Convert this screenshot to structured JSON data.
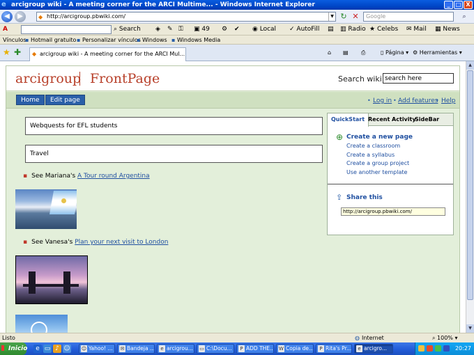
{
  "window": {
    "title": "arcigroup wiki - A meeting corner for the ARCI Multime... - Windows Internet Explorer",
    "min": "_",
    "max": "□",
    "close": "X"
  },
  "address_bar": {
    "url": "http://arcigroup.pbwiki.com/",
    "search_placeholder": "Google"
  },
  "toolbar": {
    "search_label": "Search",
    "count": "49",
    "local": "Local",
    "autofill": "AutoFill",
    "radio": "Radio",
    "celebs": "Celebs",
    "mail": "Mail",
    "news": "News"
  },
  "links_bar": {
    "label": "Vínculos",
    "items": [
      "Hotmail gratuito",
      "Personalizar vínculos",
      "Windows",
      "Windows Media"
    ]
  },
  "tab": {
    "title": "arcigroup wiki - A meeting corner for the ARCI Mul...",
    "pagina": "Página",
    "herramientas": "Herramientas"
  },
  "page": {
    "logo": "arcigroup",
    "title": "FrontPage",
    "search_label": "Search wiki:",
    "search_value": "search here",
    "nav": {
      "home": "Home",
      "edit": "Edit page",
      "login": "Log in",
      "add_features": "Add features",
      "help": "Help"
    },
    "boxes": [
      "Webquests for EFL students",
      "Travel"
    ],
    "bullets": [
      {
        "prefix": "See Mariana's ",
        "link": "A Tour round Argentina"
      },
      {
        "prefix": "See Vanesa's ",
        "link": "Plan your next visit to London"
      }
    ]
  },
  "sidebar": {
    "tabs": [
      "QuickStart",
      "Recent Activity",
      "SideBar"
    ],
    "create_title": "Create a new page",
    "create_links": [
      "Create a classroom",
      "Create a syllabus",
      "Create a group project",
      "Use another template"
    ],
    "share_title": "Share this",
    "share_url": "http://arcigroup.pbwiki.com/"
  },
  "statusbar": {
    "status": "Listo",
    "zone": "Internet",
    "zoom": "100%"
  },
  "taskbar": {
    "start": "Inicio",
    "tasks": [
      "Yahoo! ...",
      "Bandeja ...",
      "arcigrou...",
      "C:\\Docu...",
      "ADD THE...",
      "Copia de...",
      "Rita's Pr...",
      "arcigro..."
    ],
    "clock": "20:27"
  },
  "colors": {
    "brand": "#b8402a",
    "link": "#1f4fa0",
    "nav_button": "#2a5fa8",
    "page_bg": "#e3efda"
  }
}
